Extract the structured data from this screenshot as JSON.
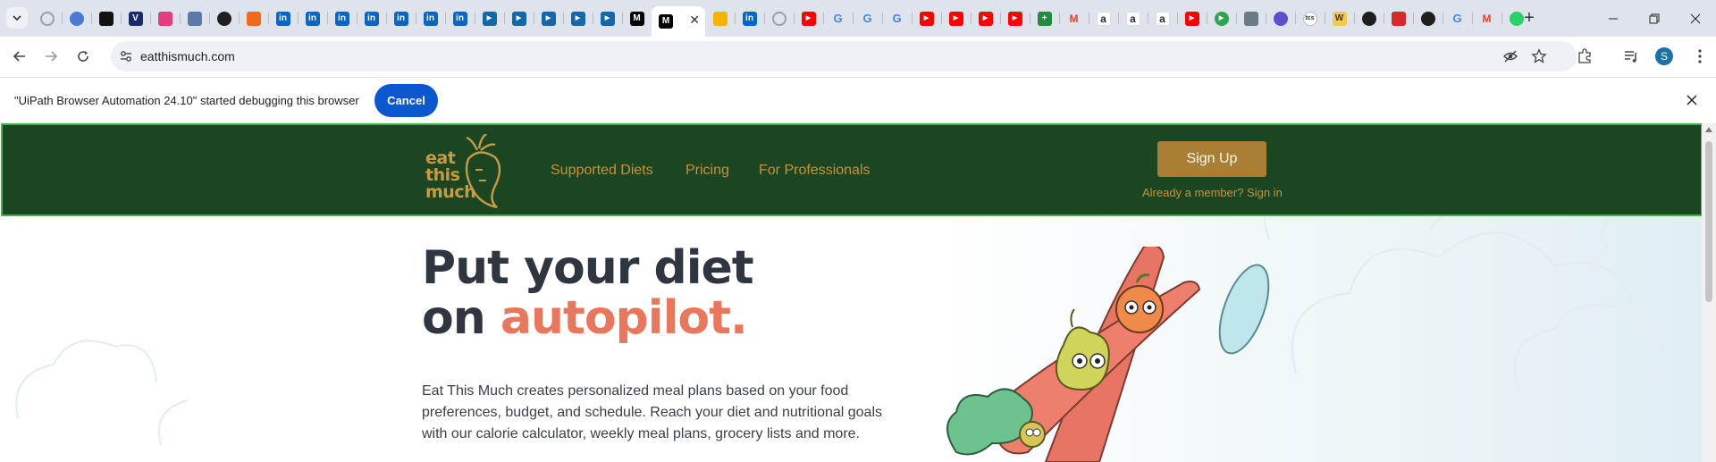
{
  "browser": {
    "tabs": [
      {
        "icon": "globe-icon",
        "color": "#9aa0a6",
        "glyph": ""
      },
      {
        "icon": "edge-icon",
        "color": "#4a7bd4",
        "glyph": ""
      },
      {
        "icon": "dark-app-icon",
        "color": "#111111",
        "glyph": ""
      },
      {
        "icon": "v-app-icon",
        "color": "#1a2a6c",
        "glyph": "V"
      },
      {
        "icon": "colorful-app-icon",
        "color": "#e23d7c",
        "glyph": ""
      },
      {
        "icon": "image-app-icon",
        "color": "#5b7aa8",
        "glyph": ""
      },
      {
        "icon": "github-icon",
        "color": "#1f1f1f",
        "glyph": ""
      },
      {
        "icon": "flame-icon",
        "color": "#f06a1d",
        "glyph": ""
      },
      {
        "icon": "linkedin-icon",
        "color": "#0a66c2",
        "glyph": "in"
      },
      {
        "icon": "linkedin-icon",
        "color": "#0a66c2",
        "glyph": "in"
      },
      {
        "icon": "linkedin-icon",
        "color": "#0a66c2",
        "glyph": "in"
      },
      {
        "icon": "linkedin-icon",
        "color": "#0a66c2",
        "glyph": "in"
      },
      {
        "icon": "linkedin-icon",
        "color": "#0a66c2",
        "glyph": "in"
      },
      {
        "icon": "linkedin-icon",
        "color": "#0a66c2",
        "glyph": "in"
      },
      {
        "icon": "linkedin-icon",
        "color": "#0a66c2",
        "glyph": "in"
      },
      {
        "icon": "play-app-icon",
        "color": "#1468a8",
        "glyph": "▶"
      },
      {
        "icon": "play-app-icon",
        "color": "#1468a8",
        "glyph": "▶"
      },
      {
        "icon": "play-app-icon",
        "color": "#1468a8",
        "glyph": "▶"
      },
      {
        "icon": "play-app-icon",
        "color": "#1468a8",
        "glyph": "▶"
      },
      {
        "icon": "play-app-icon",
        "color": "#1468a8",
        "glyph": "▶"
      },
      {
        "icon": "medium-icon",
        "color": "#000000",
        "glyph": "M"
      },
      {
        "icon": "active-tab",
        "color": "#ffffff",
        "glyph": "",
        "active": true
      },
      {
        "icon": "google-drive-icon",
        "color": "#f4b400",
        "glyph": ""
      },
      {
        "icon": "linkedin-icon",
        "color": "#0a66c2",
        "glyph": "in"
      },
      {
        "icon": "globe-icon",
        "color": "#9aa0a6",
        "glyph": ""
      },
      {
        "icon": "youtube-icon",
        "color": "#ff0000",
        "glyph": "▶"
      },
      {
        "icon": "google-icon",
        "color": "#4285f4",
        "glyph": "G"
      },
      {
        "icon": "google-icon",
        "color": "#4285f4",
        "glyph": "G"
      },
      {
        "icon": "google-icon",
        "color": "#4285f4",
        "glyph": "G"
      },
      {
        "icon": "youtube-icon",
        "color": "#ff0000",
        "glyph": "▶"
      },
      {
        "icon": "youtube-icon",
        "color": "#ff0000",
        "glyph": "▶"
      },
      {
        "icon": "youtube-icon",
        "color": "#ff0000",
        "glyph": "▶"
      },
      {
        "icon": "youtube-icon",
        "color": "#ff0000",
        "glyph": "▶"
      },
      {
        "icon": "sheets-plus-icon",
        "color": "#1e8e3e",
        "glyph": "+"
      },
      {
        "icon": "gmail-icon",
        "color": "#ea4335",
        "glyph": "M"
      },
      {
        "icon": "amazon-icon",
        "color": "#232f3e",
        "glyph": "a"
      },
      {
        "icon": "amazon-icon",
        "color": "#232f3e",
        "glyph": "a"
      },
      {
        "icon": "amazon-icon",
        "color": "#232f3e",
        "glyph": "a"
      },
      {
        "icon": "youtube-icon",
        "color": "#ff0000",
        "glyph": "▶"
      },
      {
        "icon": "green-play-icon",
        "color": "#2da44e",
        "glyph": "▶"
      },
      {
        "icon": "robot-icon",
        "color": "#6a7a86",
        "glyph": ""
      },
      {
        "icon": "circle-app-icon",
        "color": "#5a4fcf",
        "glyph": ""
      },
      {
        "icon": "tcs-icon",
        "color": "#ffffff",
        "glyph": "tcs"
      },
      {
        "icon": "w-app-icon",
        "color": "#f2c94c",
        "glyph": "W"
      },
      {
        "icon": "github-icon",
        "color": "#1f1f1f",
        "glyph": ""
      },
      {
        "icon": "crown-icon",
        "color": "#d42a2a",
        "glyph": ""
      },
      {
        "icon": "github-icon",
        "color": "#1f1f1f",
        "glyph": ""
      },
      {
        "icon": "google-icon",
        "color": "#4285f4",
        "glyph": "G"
      },
      {
        "icon": "gmail-icon",
        "color": "#ea4335",
        "glyph": "M"
      },
      {
        "icon": "whatsapp-icon",
        "color": "#25d366",
        "glyph": ""
      }
    ],
    "url": "eatthismuch.com",
    "profile_initial": "S"
  },
  "infobar": {
    "message": "\"UiPath Browser Automation 24.10\" started debugging this browser",
    "cancel_label": "Cancel"
  },
  "site": {
    "logo_text": [
      "eat",
      "this",
      "much"
    ],
    "nav_links": [
      "Supported Diets",
      "Pricing",
      "For Professionals"
    ],
    "signup_label": "Sign Up",
    "signin_label": "Already a member? Sign in",
    "hero_title_line1": "Put your diet",
    "hero_title_line2_prefix": "on ",
    "hero_title_accent": "autopilot.",
    "hero_description": "Eat This Much creates personalized meal plans based on your food preferences, budget, and schedule. Reach your diet and nutritional goals with our calorie calculator, weekly meal plans, grocery lists and more.",
    "colors": {
      "nav_bg": "#1b4621",
      "nav_link": "#c7913d",
      "signup_bg": "#a97f35",
      "accent": "#e9775c",
      "title": "#2f3640"
    }
  }
}
